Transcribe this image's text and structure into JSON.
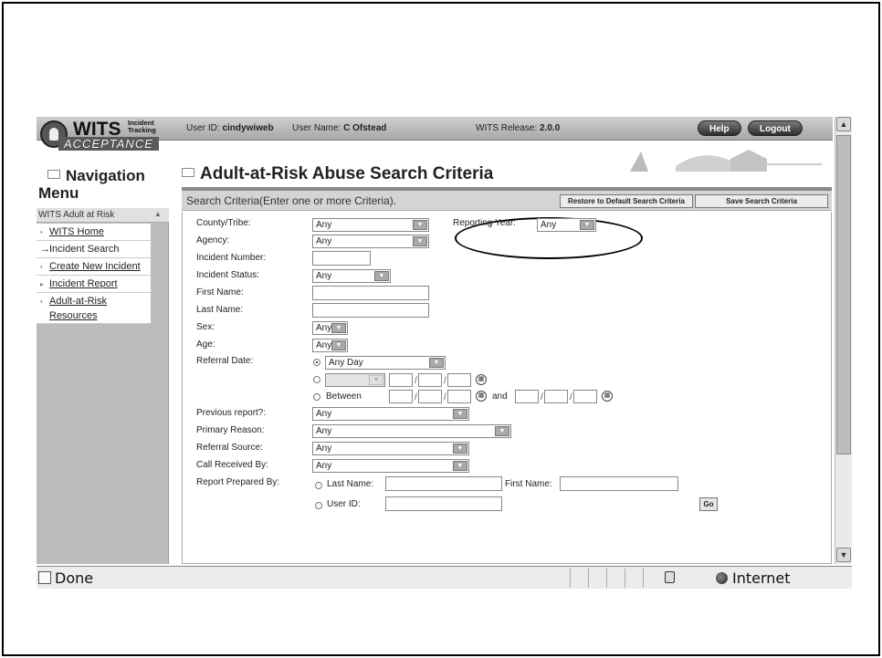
{
  "header": {
    "logo_text": "WITS",
    "logo_sub": "Incident Tracking",
    "logo_acc": "ACCEPTANCE",
    "user_id_label": "User ID:",
    "user_id_value": "cindywiweb",
    "user_name_label": "User Name:",
    "user_name_value": "C Ofstead",
    "release_label": "WITS Release:",
    "release_value": "2.0.0",
    "help_label": "Help",
    "logout_label": "Logout"
  },
  "nav": {
    "title": "Navigation Menu",
    "subheader": "WITS Adult at Risk",
    "items": [
      {
        "label": "WITS Home",
        "marker": "•"
      },
      {
        "label": "Incident Search",
        "marker": "→"
      },
      {
        "label": "Create New Incident",
        "marker": "•"
      },
      {
        "label": "Incident Report",
        "marker": "▸"
      },
      {
        "label": "Adult-at-Risk Resources",
        "marker": "•"
      }
    ]
  },
  "main": {
    "title": "Adult-at-Risk Abuse Search Criteria",
    "criteria_label": "Search Criteria(Enter one or more Criteria).",
    "restore_button": "Restore to Default Search Criteria",
    "save_button": "Save Search Criteria"
  },
  "form": {
    "county_label": "County/Tribe:",
    "county_value": "Any",
    "reporting_year_label": "Reporting Year:",
    "reporting_year_value": "Any",
    "agency_label": "Agency:",
    "agency_value": "Any",
    "incident_number_label": "Incident Number:",
    "incident_status_label": "Incident Status:",
    "incident_status_value": "Any",
    "first_name_label": "First Name:",
    "last_name_label": "Last Name:",
    "sex_label": "Sex:",
    "sex_value": "Any",
    "age_label": "Age:",
    "age_value": "Any",
    "referral_date_label": "Referral Date:",
    "referral_date_value": "Any Day",
    "between_label": "Between",
    "and_label": "and",
    "previous_report_label": "Previous report?:",
    "previous_report_value": "Any",
    "primary_reason_label": "Primary Reason:",
    "primary_reason_value": "Any",
    "referral_source_label": "Referral Source:",
    "referral_source_value": "Any",
    "call_received_label": "Call Received By:",
    "call_received_value": "Any",
    "report_prepared_label": "Report Prepared By:",
    "last_name_radio_label": "Last Name:",
    "first_name_inline_label": "First Name:",
    "user_id_radio_label": "User ID:",
    "go_button": "Go"
  },
  "status_bar": {
    "left_text": "Done",
    "zone_text": "Internet"
  }
}
